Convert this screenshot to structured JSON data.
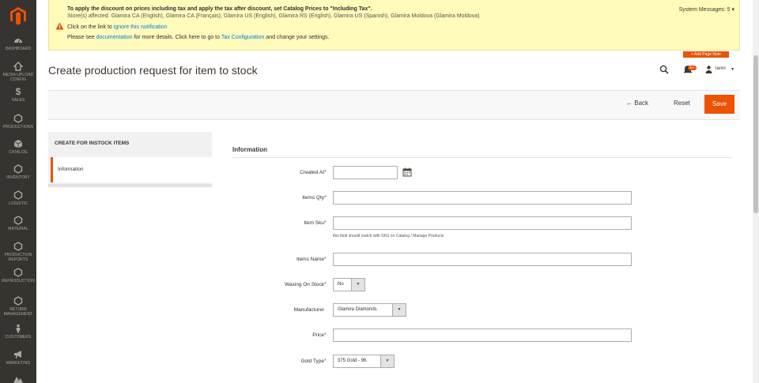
{
  "nav": {
    "items": [
      {
        "label": "Dashboard"
      },
      {
        "label": "Media Upload Config"
      },
      {
        "label": "Sales"
      },
      {
        "label": "Productions"
      },
      {
        "label": "Catalog"
      },
      {
        "label": "Inventory"
      },
      {
        "label": "Logistic"
      },
      {
        "label": "Material"
      },
      {
        "label": "Production Reports"
      },
      {
        "label": "Reproduction"
      },
      {
        "label": "Return Management"
      },
      {
        "label": "Customers"
      },
      {
        "label": "Marketing"
      }
    ]
  },
  "message": {
    "line1": "To apply the discount on prices including tax and apply the tax after discount, set Catalog Prices to \"Including Tax\".",
    "line2": "Store(s) affected: Glamira CA (English), Glamira CA (Français), Glamira US (English), Glamira RS (English), Glamira US (Spanish), Glamira Moldova (Glamira Moldova)",
    "line3_prefix": "Click on the link to",
    "line3_link": "ignore this notification",
    "line4_prefix": "Please see",
    "line4_link1": "documentation",
    "line4_mid": "for more details. Click here to go to",
    "line4_link2": "Tax Configuration",
    "line4_suffix": "and change your settings.",
    "system_messages": "System Messages: 5"
  },
  "header": {
    "add_page_note": "+ Add Page Note",
    "title": "Create production request for item to stock",
    "notifications_count": "99+",
    "user": "lanni"
  },
  "actions": {
    "back": "Back",
    "reset": "Reset",
    "save": "Save"
  },
  "tabs": {
    "heading": "CREATE FOR INSTOCK ITEMS",
    "active": "Information"
  },
  "form": {
    "section": "Information",
    "created_at": {
      "label": "Created At",
      "value": ""
    },
    "items_qty": {
      "label": "Items Qty",
      "value": ""
    },
    "item_sku": {
      "label": "Item Sku",
      "value": "",
      "note": "this field should match with SKU on Catalog / Manage Products"
    },
    "items_name": {
      "label": "Items Name",
      "value": ""
    },
    "waxing": {
      "label": "Waxing On Stock",
      "value": "No"
    },
    "manufacturer": {
      "label": "Manufacturer",
      "value": "Glamira Diamonds"
    },
    "price": {
      "label": "Price",
      "value": ""
    },
    "gold_type": {
      "label": "Gold Type",
      "value": "375 Gold - 9K"
    },
    "required_mark": "*"
  },
  "colors": {
    "accent": "#eb5202",
    "nav_bg": "#373330",
    "message_bg": "#fffbbb",
    "link": "#007bdb",
    "required": "#e22626"
  }
}
